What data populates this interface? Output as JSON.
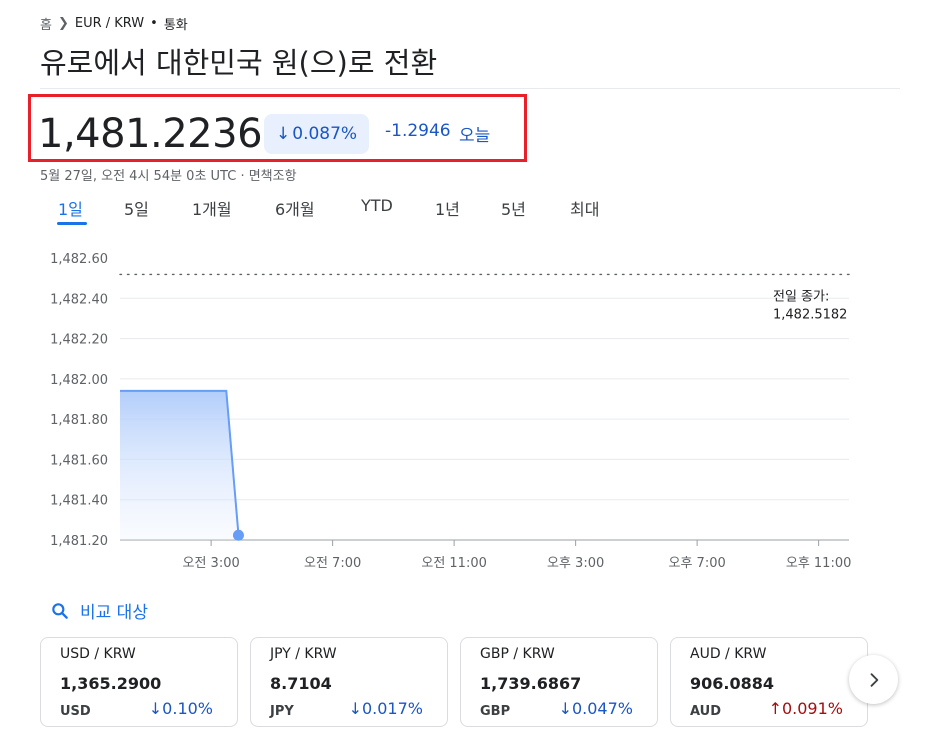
{
  "breadcrumb": {
    "home": "홈",
    "pair": "EUR / KRW",
    "separator": "•",
    "category": "통화"
  },
  "title": "유로에서 대한민국 원(으)로 전환",
  "quote": {
    "price": "1,481.2236",
    "change_pct": "0.087%",
    "change_abs": "-1.2946",
    "period_label": "오늘",
    "direction": "down"
  },
  "timestamp": "5월 27일, 오전 4시 54분 0초 UTC · 면책조항",
  "tabs": [
    {
      "label": "1일",
      "active": true
    },
    {
      "label": "5일",
      "active": false
    },
    {
      "label": "1개월",
      "active": false
    },
    {
      "label": "6개월",
      "active": false
    },
    {
      "label": "YTD",
      "active": false
    },
    {
      "label": "1년",
      "active": false
    },
    {
      "label": "5년",
      "active": false
    },
    {
      "label": "최대",
      "active": false
    }
  ],
  "chart_data": {
    "type": "area",
    "ylim": [
      1481.2,
      1482.6
    ],
    "y_ticks": [
      "1,482.60",
      "1,482.40",
      "1,482.20",
      "1,482.00",
      "1,481.80",
      "1,481.60",
      "1,481.40",
      "1,481.20"
    ],
    "x_ticks": [
      "오전 3:00",
      "오전 7:00",
      "오전 11:00",
      "오후 3:00",
      "오후 7:00",
      "오후 11:00"
    ],
    "series": [
      {
        "points": [
          {
            "t": "오전 0:00",
            "value": 1481.94
          },
          {
            "t": "오전 3:30",
            "value": 1481.94
          },
          {
            "t": "오전 3:54",
            "value": 1481.2236
          }
        ]
      }
    ],
    "previous_close": {
      "label_line1": "전일 종가:",
      "label_line2": "1,482.5182",
      "value": 1482.5182
    },
    "colors": {
      "line": "#669df6",
      "fill_top": "#aecbfa",
      "grid": "#e8eaed",
      "prev_close": "#5f6368"
    }
  },
  "compare": {
    "label": "비교 대상",
    "icon": "search-icon"
  },
  "cards": [
    {
      "pair": "USD / KRW",
      "rate": "1,365.2900",
      "code": "USD",
      "pct": "0.10%",
      "direction": "down",
      "arrow": "↓"
    },
    {
      "pair": "JPY / KRW",
      "rate": "8.7104",
      "code": "JPY",
      "pct": "0.017%",
      "direction": "down",
      "arrow": "↓"
    },
    {
      "pair": "GBP / KRW",
      "rate": "1,739.6867",
      "code": "GBP",
      "pct": "0.047%",
      "direction": "down",
      "arrow": "↓"
    },
    {
      "pair": "AUD / KRW",
      "rate": "906.0884",
      "code": "AUD",
      "pct": "0.091%",
      "direction": "up",
      "arrow": "↑"
    }
  ],
  "next_button": {
    "icon": "chevron-right-icon"
  }
}
